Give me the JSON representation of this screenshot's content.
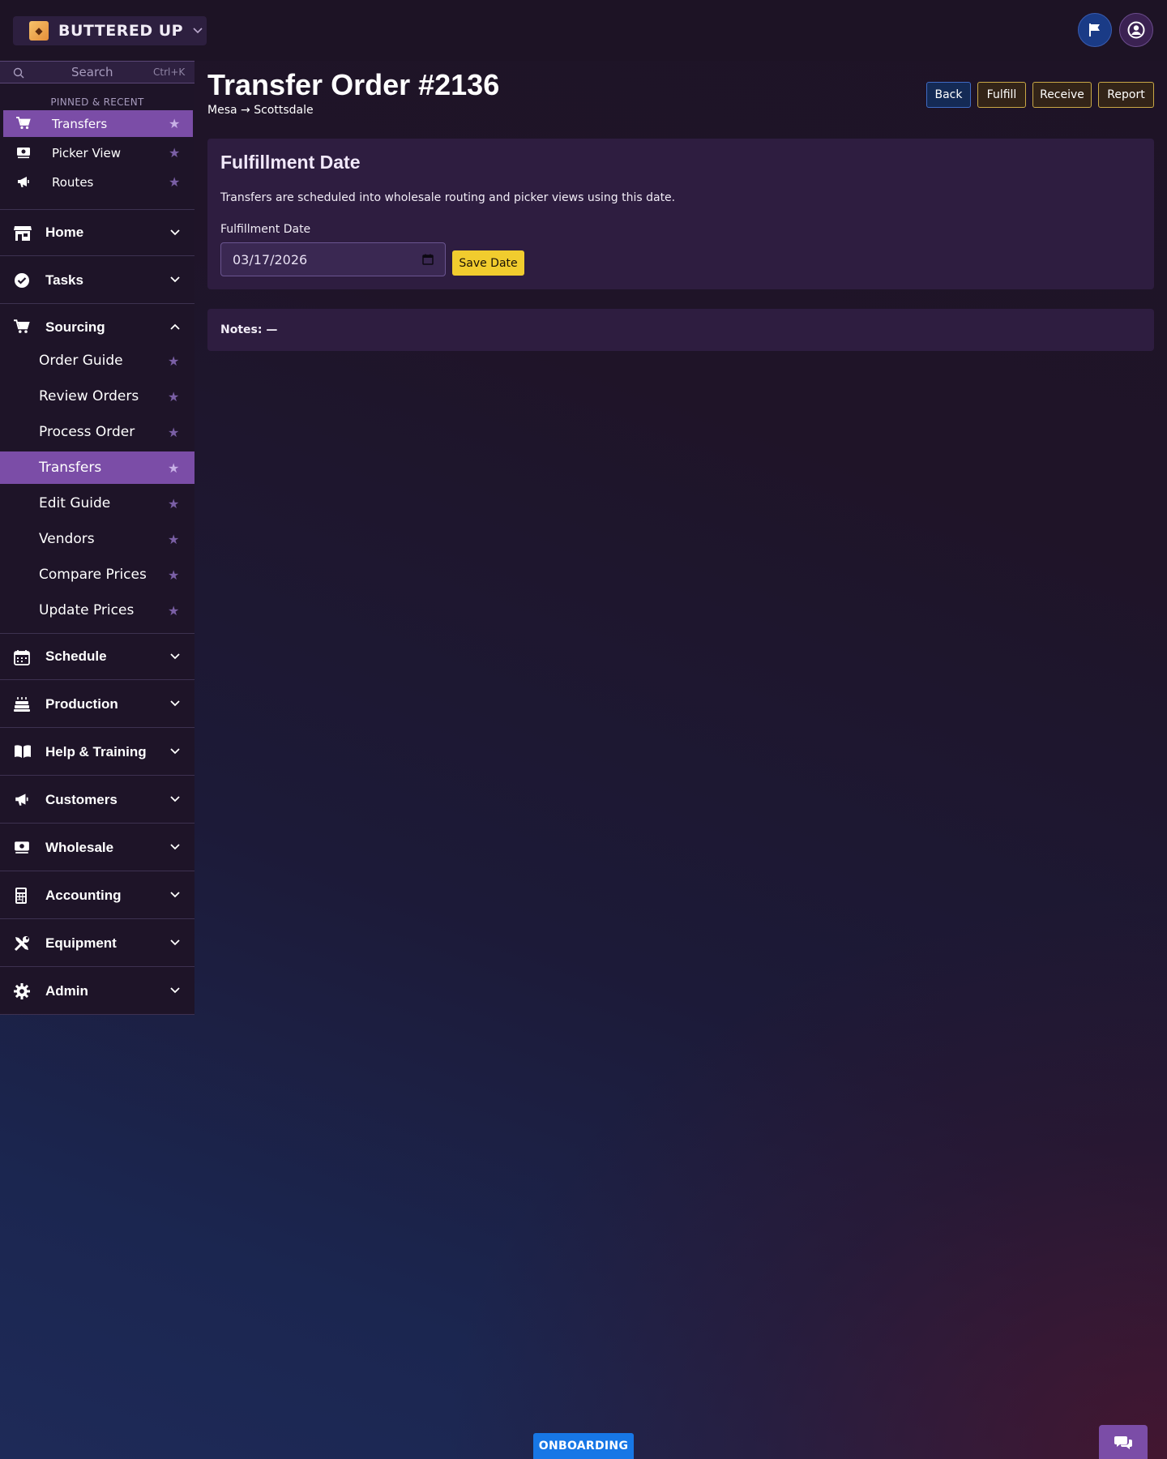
{
  "app": {
    "brand_name": "BUTTERED UP"
  },
  "colors": {
    "accent": "#7b4da7",
    "gold": "#f1cc2e",
    "blue": "#1777e6"
  },
  "sidebar": {
    "search_placeholder": "Search",
    "search_shortcut": "Ctrl+K",
    "pinned_title": "PINNED & RECENT",
    "pinned": [
      {
        "label": "Transfers",
        "icon": "cart-icon",
        "active": true
      },
      {
        "label": "Picker View",
        "icon": "money-icon",
        "active": false
      },
      {
        "label": "Routes",
        "icon": "megaphone-icon",
        "active": false
      }
    ],
    "sections": [
      {
        "label": "Home",
        "icon": "store-icon",
        "expanded": false
      },
      {
        "label": "Tasks",
        "icon": "check-circle-icon",
        "expanded": false
      },
      {
        "label": "Sourcing",
        "icon": "cart-icon",
        "expanded": true
      },
      {
        "label": "Schedule",
        "icon": "calendar-icon",
        "expanded": false
      },
      {
        "label": "Production",
        "icon": "cake-icon",
        "expanded": false
      },
      {
        "label": "Help & Training",
        "icon": "book-icon",
        "expanded": false
      },
      {
        "label": "Customers",
        "icon": "megaphone-icon",
        "expanded": false
      },
      {
        "label": "Wholesale",
        "icon": "money-icon",
        "expanded": false
      },
      {
        "label": "Accounting",
        "icon": "calculator-icon",
        "expanded": false
      },
      {
        "label": "Equipment",
        "icon": "tools-icon",
        "expanded": false
      },
      {
        "label": "Admin",
        "icon": "gear-icon",
        "expanded": false
      }
    ],
    "sourcing_items": [
      {
        "label": "Order Guide",
        "active": false
      },
      {
        "label": "Review Orders",
        "active": false
      },
      {
        "label": "Process Order",
        "active": false
      },
      {
        "label": "Transfers",
        "active": true
      },
      {
        "label": "Edit Guide",
        "active": false
      },
      {
        "label": "Vendors",
        "active": false
      },
      {
        "label": "Compare Prices",
        "active": false
      },
      {
        "label": "Update Prices",
        "active": false
      }
    ]
  },
  "header": {
    "title": "Transfer Order #2136",
    "route": "Mesa → Scottsdale",
    "buttons": {
      "back": "Back",
      "fulfill": "Fulfill",
      "receive": "Receive",
      "report": "Report"
    }
  },
  "fulfillment": {
    "title": "Fulfillment Date",
    "description": "Transfers are scheduled into wholesale routing and picker views using this date.",
    "field_label": "Fulfillment Date",
    "date_value": "03/17/2026",
    "save_label": "Save Date"
  },
  "notes": {
    "text": "Notes: —"
  },
  "footer": {
    "onboarding_label": "ONBOARDING"
  }
}
